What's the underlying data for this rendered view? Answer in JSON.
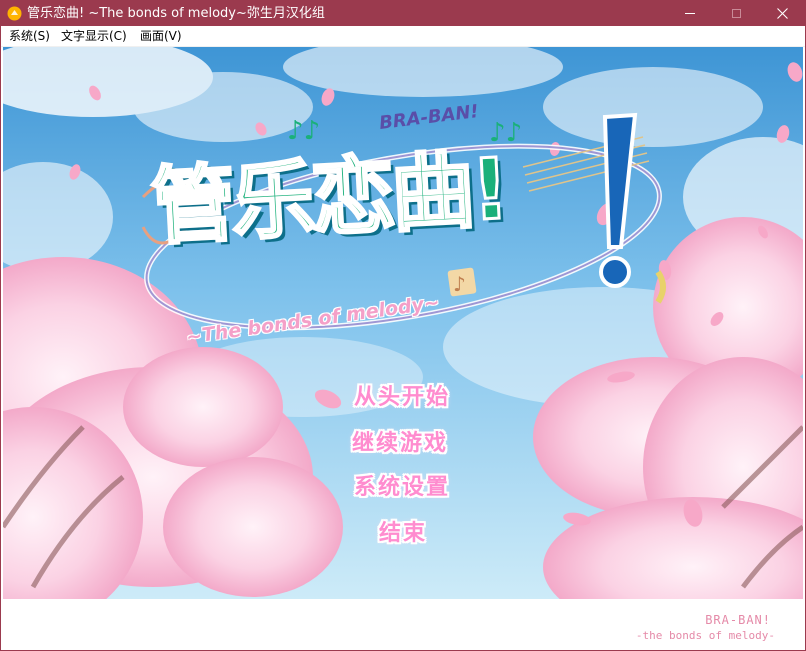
{
  "window": {
    "title": "管乐恋曲! ~The bonds of melody~弥生月汉化组",
    "app_icon": "orange-circle-icon",
    "controls": [
      "minimize",
      "maximize",
      "close"
    ]
  },
  "menubar": {
    "items": [
      {
        "label": "系统(S)"
      },
      {
        "label": "文字显示(C)"
      },
      {
        "label": "画面(V)"
      }
    ]
  },
  "game": {
    "logo": {
      "title": "管乐恋曲!",
      "brand_small": "BRA-BAN!",
      "subtitle": "~The bonds of melody~"
    },
    "title_menu": [
      {
        "label": "从头开始"
      },
      {
        "label": "继续游戏"
      },
      {
        "label": "系统设置"
      },
      {
        "label": "结束"
      }
    ],
    "colors": {
      "sky_top": "#3f97d6",
      "sky_bottom": "#bfe4f7",
      "sakura": "#f9c6dd",
      "menu_text": "#ff8ccf",
      "logo_green": "#1ab07a",
      "logo_blue": "#1866b8"
    }
  },
  "footer": {
    "brand": "BRA-BAN!",
    "subtitle": "-the bonds of melody-"
  }
}
